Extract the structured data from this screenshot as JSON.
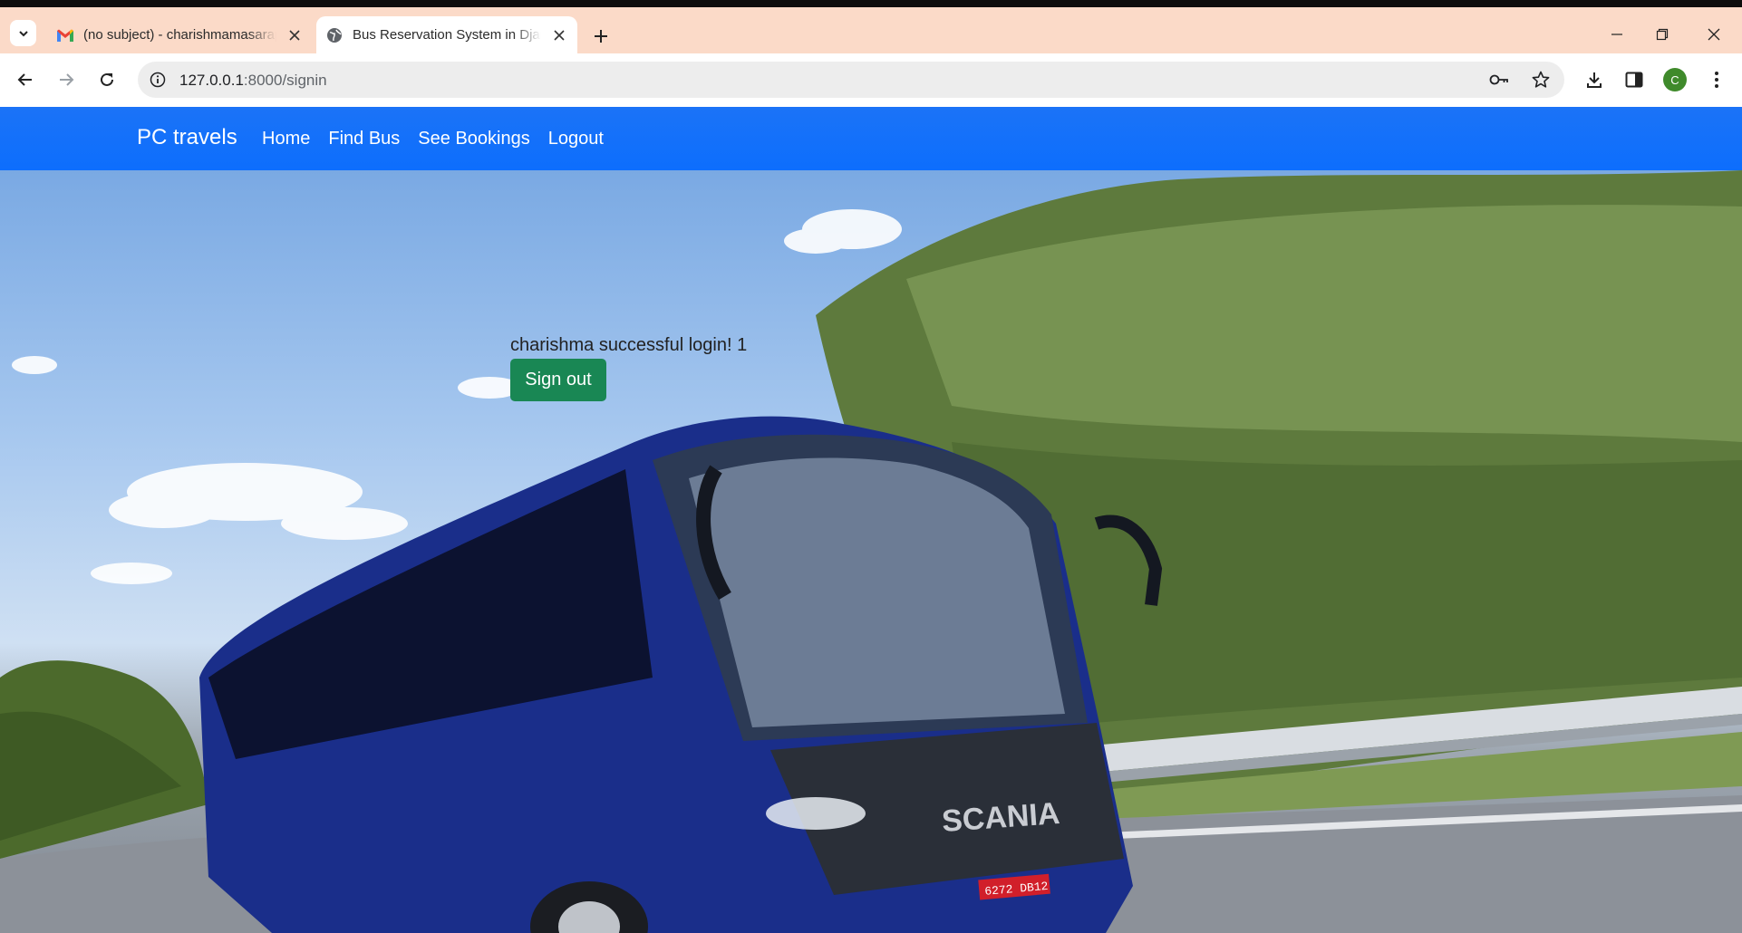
{
  "browser": {
    "tabs": [
      {
        "title": "(no subject) - charishmamasarapu",
        "favicon": "gmail-icon",
        "active": false
      },
      {
        "title": "Bus Reservation System in Django",
        "favicon": "globe-icon",
        "active": true
      }
    ],
    "url_host": "127.0.0.1",
    "url_path": ":8000/signin",
    "profile_initial": "C"
  },
  "navbar": {
    "brand": "PC travels",
    "links": [
      "Home",
      "Find Bus",
      "See Bookings",
      "Logout"
    ]
  },
  "main": {
    "message": "charishma successful login! 1",
    "signout_label": "Sign out"
  },
  "hero_image": {
    "bus_badge": "SCANIA",
    "plate": "6272 DB12"
  },
  "colors": {
    "navbar": "#0d6efd",
    "signout_button": "#198754",
    "tabbar": "#fbdac8"
  }
}
